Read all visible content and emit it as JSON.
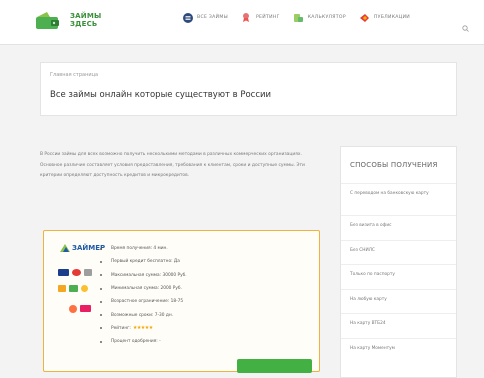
{
  "header": {
    "logo_text_line1": "ЗАЙМЫ",
    "logo_text_line2": "ЗДЕСЬ",
    "nav": [
      {
        "label": "ВСЕ ЗАЙМЫ",
        "icon": "list-icon"
      },
      {
        "label": "РЕЙТИНГ",
        "icon": "rating-icon"
      },
      {
        "label": "КАЛЬКУЛЯТОР",
        "icon": "calculator-icon"
      },
      {
        "label": "ПУБЛИКАЦИИ",
        "icon": "publications-icon"
      }
    ]
  },
  "title_card": {
    "breadcrumb": "Главная страница",
    "title": "Все займы онлайн которые существуют в России"
  },
  "intro": "В России займы для всех возможно получить несколькими методами в различных коммерческих организациях. Основное различие составляет условия предоставления, требования к клиентам, сроки и доступные суммы. Эти критерии определяют доступность кредитов и микрокредитов.",
  "offer": {
    "brand": "ЗАЙМЕР",
    "features": [
      "Время получения: 4 мин.",
      "Первый кредит бесплатно: Да",
      "Максимальная сумма: 30000 Руб.",
      "Минимальная сумма: 2000 Руб.",
      "Возрастное ограничение: 18-75",
      "Возможные сроки: 7-30 дн.",
      "Рейтинг:",
      "Процент одобрения: -"
    ],
    "rating_stars": "★★★★★",
    "colors": {
      "border": "#f0b23e",
      "button": "#43b043"
    }
  },
  "sidebar": {
    "title": "СПОСОБЫ ПОЛУЧЕНИЯ",
    "items": [
      "С переводом на банковскую карту",
      "Без визита в офис",
      "Без СНИЛС",
      "Только по паспорту",
      "На любую карту",
      "На карту ВТБ24",
      "На карту Моментум"
    ]
  }
}
